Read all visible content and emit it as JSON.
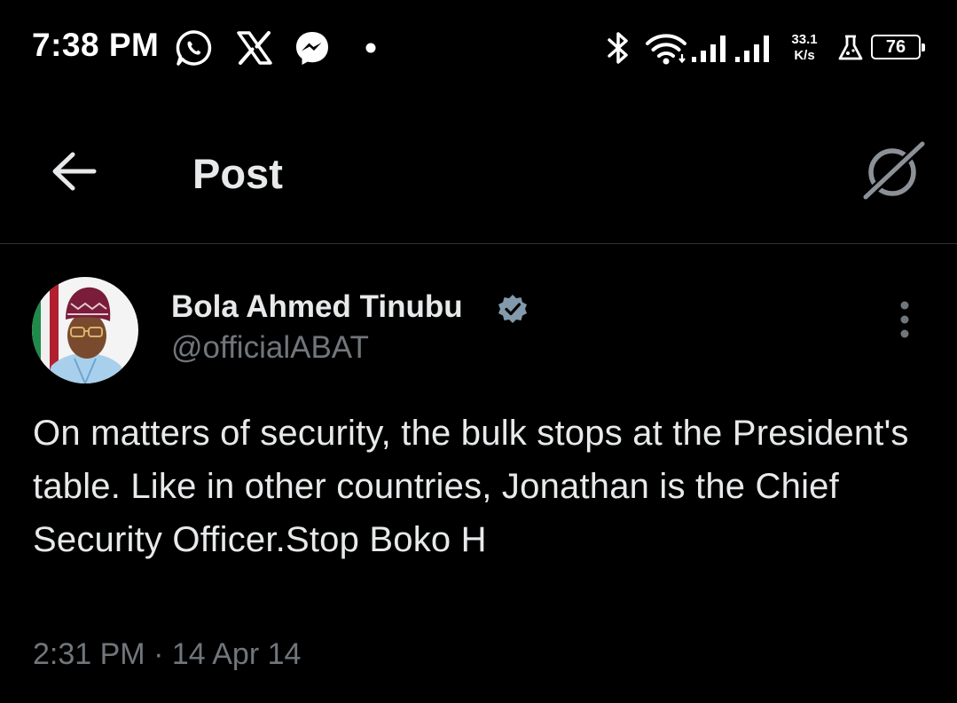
{
  "status_bar": {
    "time": "7:38 PM",
    "net_speed_value": "33.1",
    "net_speed_unit": "K/s",
    "battery_level": "76",
    "notification_icons": [
      "whatsapp-icon",
      "x-logo-icon",
      "messenger-icon",
      "dot-icon"
    ],
    "system_icons": [
      "bluetooth-icon",
      "wifi-icon",
      "signal-icon",
      "signal-icon",
      "flask-icon",
      "battery-icon"
    ]
  },
  "header": {
    "title": "Post",
    "back_icon": "arrow-left-icon",
    "grok_icon": "grok-icon"
  },
  "post": {
    "author_name": "Bola Ahmed Tinubu",
    "handle": "@officialABAT",
    "verified": true,
    "verified_color": "#829aab",
    "text": "On matters of security, the bulk stops at the President's table. Like in other countries, Jonathan is the Chief Security Officer.Stop Boko H",
    "time": "2:31 PM",
    "separator": "·",
    "date": "14 Apr 14"
  },
  "colors": {
    "background": "#000000",
    "primary_text": "#e7e9ea",
    "secondary_text": "#71767b",
    "divider": "#2f3336"
  }
}
